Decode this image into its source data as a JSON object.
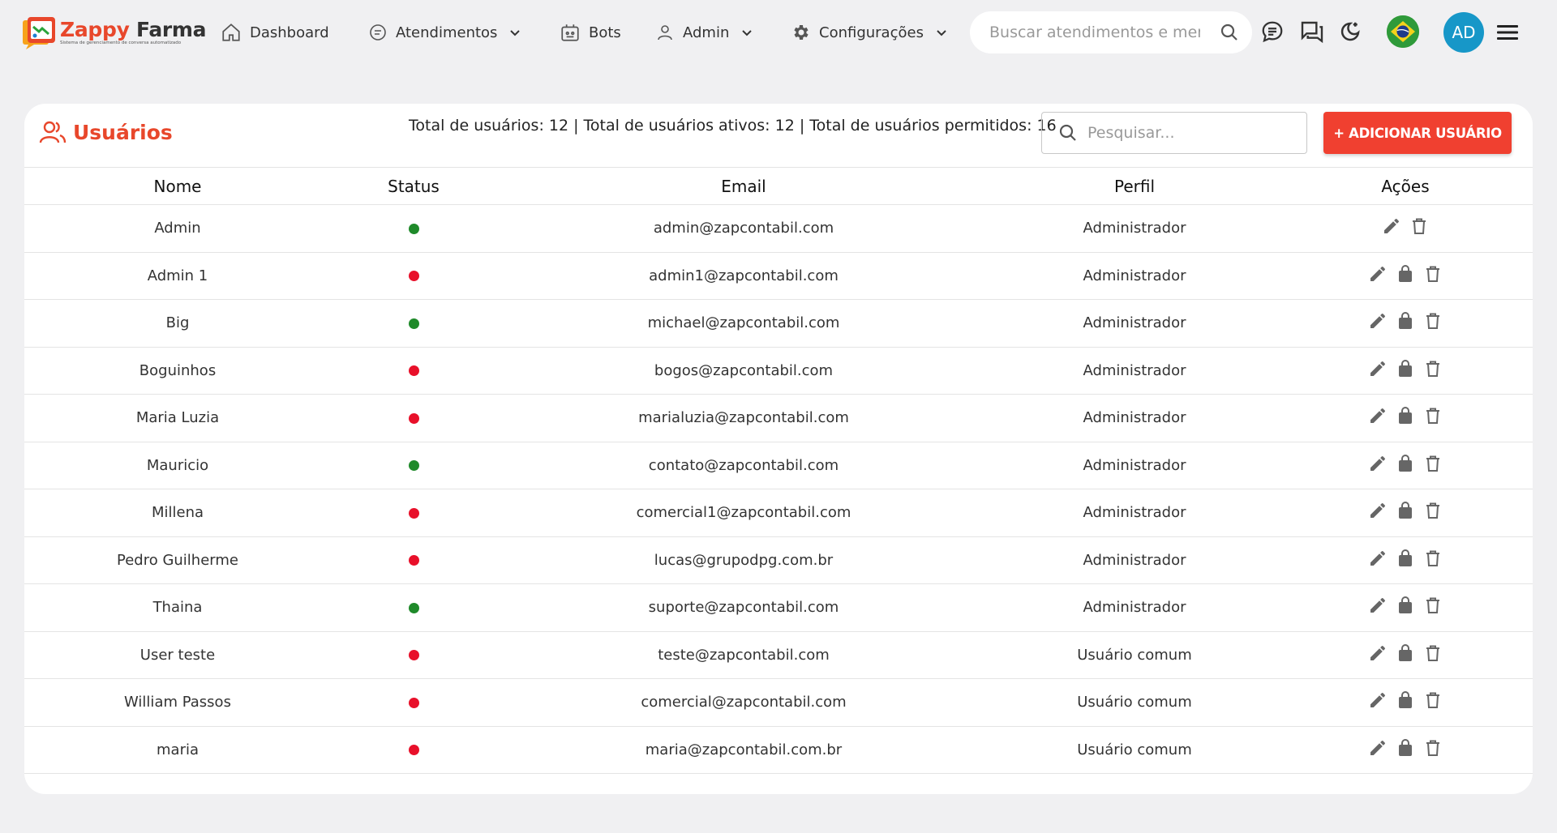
{
  "app": {
    "brand_word1": "Zappy",
    "brand_word2": "Farma",
    "tagline": "Sistema de gerenciamento de conversa automatizado"
  },
  "nav": {
    "dashboard": "Dashboard",
    "atendimentos": "Atendimentos",
    "bots": "Bots",
    "admin": "Admin",
    "configuracoes": "Configurações"
  },
  "top_search": {
    "placeholder": "Buscar atendimentos e mensagens"
  },
  "user": {
    "initials": "AD"
  },
  "page": {
    "title": "Usuários",
    "totals": "Total de usuários: 12 | Total de usuários ativos: 12 | Total de usuários permitidos: 16",
    "search_placeholder": "Pesquisar...",
    "add_button": "+ ADICIONAR USUÁRIO"
  },
  "colors": {
    "brand": "#e8472b",
    "button": "#f04030",
    "status_on": "#1f8a2a",
    "status_off": "#e8102a",
    "avatar": "#1797c8"
  },
  "table": {
    "headers": {
      "name": "Nome",
      "status": "Status",
      "email": "Email",
      "profile": "Perfil",
      "actions": "Ações"
    },
    "rows": [
      {
        "name": "Admin",
        "status": "on",
        "email": "admin@zapcontabil.com",
        "profile": "Administrador",
        "lock": false
      },
      {
        "name": "Admin 1",
        "status": "off",
        "email": "admin1@zapcontabil.com",
        "profile": "Administrador",
        "lock": true
      },
      {
        "name": "Big",
        "status": "on",
        "email": "michael@zapcontabil.com",
        "profile": "Administrador",
        "lock": true
      },
      {
        "name": "Boguinhos",
        "status": "off",
        "email": "bogos@zapcontabil.com",
        "profile": "Administrador",
        "lock": true
      },
      {
        "name": "Maria Luzia",
        "status": "off",
        "email": "marialuzia@zapcontabil.com",
        "profile": "Administrador",
        "lock": true
      },
      {
        "name": "Mauricio",
        "status": "on",
        "email": "contato@zapcontabil.com",
        "profile": "Administrador",
        "lock": true
      },
      {
        "name": "Millena",
        "status": "off",
        "email": "comercial1@zapcontabil.com",
        "profile": "Administrador",
        "lock": true
      },
      {
        "name": "Pedro Guilherme",
        "status": "off",
        "email": "lucas@grupodpg.com.br",
        "profile": "Administrador",
        "lock": true
      },
      {
        "name": "Thaina",
        "status": "on",
        "email": "suporte@zapcontabil.com",
        "profile": "Administrador",
        "lock": true
      },
      {
        "name": "User teste",
        "status": "off",
        "email": "teste@zapcontabil.com",
        "profile": "Usuário comum",
        "lock": true
      },
      {
        "name": "William Passos",
        "status": "off",
        "email": "comercial@zapcontabil.com",
        "profile": "Usuário comum",
        "lock": true
      },
      {
        "name": "maria",
        "status": "off",
        "email": "maria@zapcontabil.com.br",
        "profile": "Usuário comum",
        "lock": true
      }
    ]
  }
}
